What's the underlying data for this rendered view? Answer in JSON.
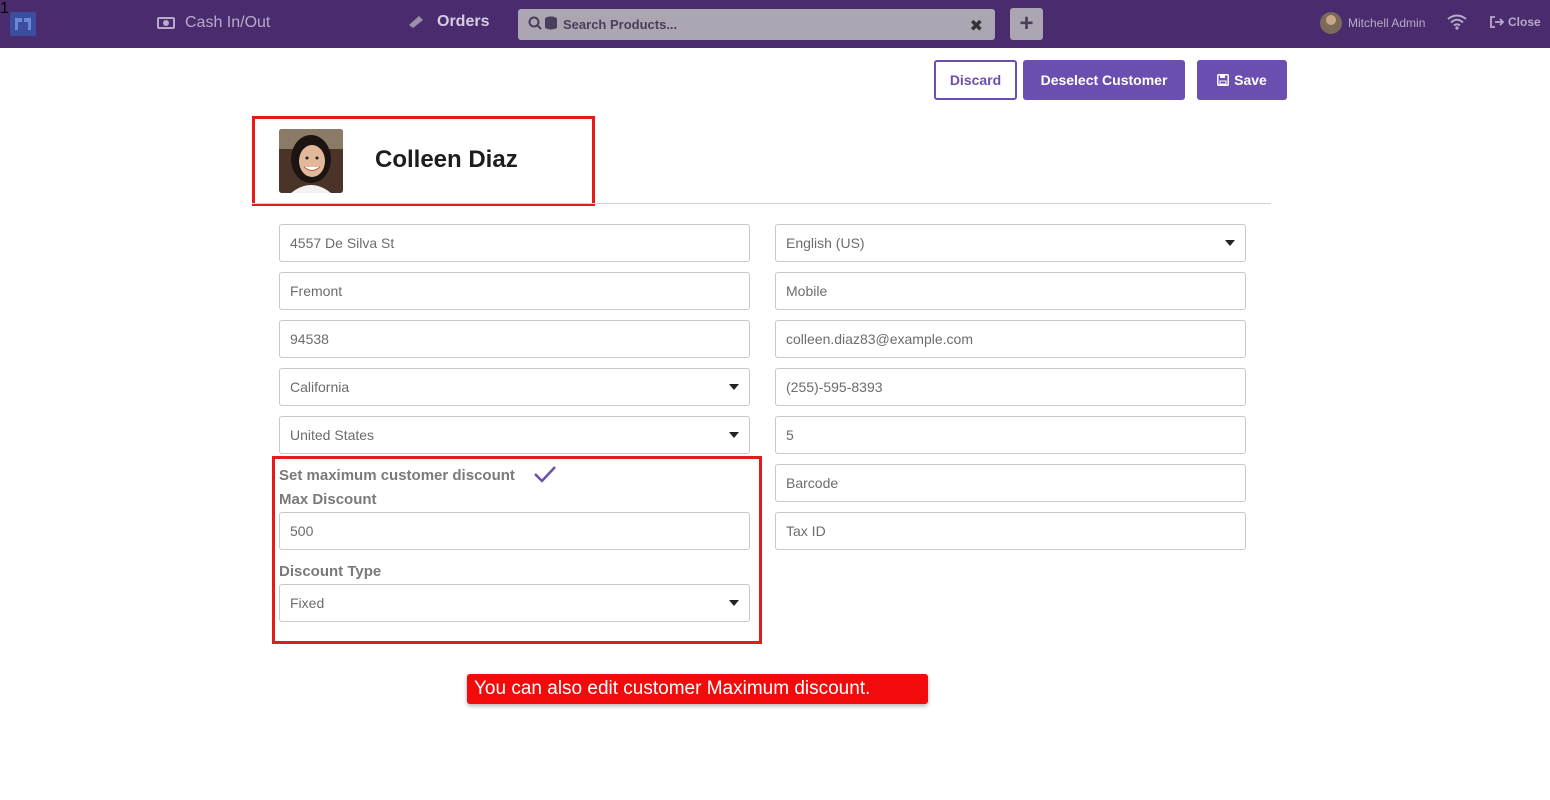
{
  "topbar": {
    "cash_label": "Cash In/Out",
    "orders_label": "Orders",
    "orders_count": "1",
    "search_placeholder": "Search Products...",
    "user_name": "Mitchell Admin",
    "close_label": "Close"
  },
  "actions": {
    "discard": "Discard",
    "deselect": "Deselect Customer",
    "save": "Save"
  },
  "customer": {
    "name": "Colleen Diaz"
  },
  "left_fields": {
    "street": "4557 De Silva St",
    "city": "Fremont",
    "zip": "94538",
    "state": "California",
    "country": "United States"
  },
  "right_fields": {
    "language": "English (US)",
    "mobile_placeholder": "Mobile",
    "email": "colleen.diaz83@example.com",
    "phone": "(255)-595-8393",
    "field5": "5",
    "barcode_placeholder": "Barcode",
    "taxid_placeholder": "Tax ID"
  },
  "discount": {
    "toggle_label": "Set maximum customer discount",
    "toggle_checked": true,
    "max_label": "Max Discount",
    "max_value": "500",
    "type_label": "Discount Type",
    "type_value": "Fixed"
  },
  "tooltip": "You can also edit customer Maximum discount.",
  "colors": {
    "topbar": "#4a2b6e",
    "accent": "#6b4fb0",
    "highlight": "#e41b1b"
  }
}
